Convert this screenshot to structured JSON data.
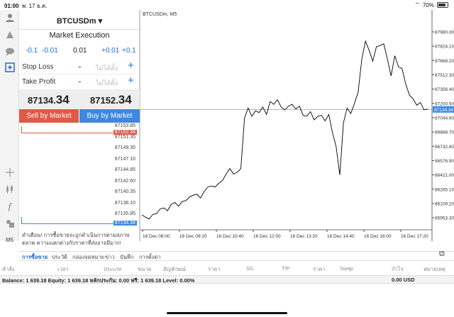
{
  "status": {
    "time": "01:00",
    "date": "พ. 17 ธ.ค.",
    "battery": "70%",
    "battery_level": 0.7
  },
  "order_panel": {
    "symbol": "BTCUSDm",
    "execution": "Market Execution",
    "adjust": [
      "-0.1",
      "-0.01",
      "0.01",
      "+0.01",
      "+0.1"
    ],
    "stop_loss": {
      "label": "Stop Loss",
      "placeholder": "ไม่ได้ตั้ง"
    },
    "take_profit": {
      "label": "Take Profit",
      "placeholder": "ไม่ได้ตั้ง"
    },
    "bid": {
      "main": "87134.",
      "big": "34"
    },
    "ask": {
      "main": "87152.",
      "big": "34"
    },
    "sell_label": "Sell by Market",
    "buy_label": "Buy by Market",
    "ladder": [
      "87153.85",
      "87151.35",
      "87149.35",
      "87147.10",
      "87144.85",
      "87142.60",
      "87140.35",
      "87138.10",
      "87135.85"
    ],
    "ask_tag": "87152.34",
    "bid_tag": "87134.34",
    "warning": "คำเตือน! การซื้อขายจะถูกดำเนินการตามสภาพตลาด ความแตกต่างกับราคาที่ส่งอาจมีมาก!"
  },
  "chart": {
    "title": "BTCUSDm, M5",
    "price_labels": [
      "87980.00",
      "87824.10",
      "87668.20",
      "87512.30",
      "87356.40",
      "87200.50",
      "87044.60",
      "86888.70",
      "86732.80",
      "86576.90",
      "86421.00",
      "86265.10",
      "86109.20",
      "85953.30"
    ],
    "bid_tag": "87134.34",
    "time_labels": [
      "16 Dec 08:00",
      "16 Dec 09:20",
      "16 Dec 10:40",
      "16 Dec 12:00",
      "16 Dec 13:20",
      "16 Dec 14:40",
      "16 Dec 16:00",
      "16 Dec 17:20"
    ],
    "colors": {
      "line": "#000000",
      "bid_line": "#9aa7b5",
      "bid_tag_bg": "#3d88e0"
    }
  },
  "chart_data": {
    "type": "line",
    "title": "BTCUSDm, M5",
    "ylim": [
      85900,
      88080
    ],
    "y": [
      85985,
      85960,
      85940,
      85990,
      86000,
      86050,
      86060,
      86030,
      86100,
      86120,
      86080,
      86130,
      86140,
      86180,
      86200,
      86210,
      86170,
      86240,
      86290,
      86300,
      86290,
      86330,
      86360,
      86430,
      86490,
      86430,
      86450,
      86490,
      87040,
      87150,
      87060,
      87120,
      87100,
      87160,
      87080,
      87220,
      87190,
      87240,
      87160,
      87130,
      87170,
      87190,
      87140,
      87170,
      87070,
      87060,
      87110,
      87020,
      87060,
      87070,
      87010,
      87080,
      86880,
      86730,
      86420,
      86990,
      87150,
      87090,
      87200,
      87320,
      87680,
      87880,
      87780,
      87660,
      87820,
      87830,
      87850,
      87680,
      87500,
      87720,
      87600,
      87580,
      87410,
      87290,
      87250,
      87180,
      87210,
      87130,
      87140
    ],
    "grid": false
  },
  "tabs": [
    "การซื้อขาย",
    "ประวัติ",
    "กล่องจดหมาย",
    "ข่าว",
    "บันทึก",
    "การตั้งค่า"
  ],
  "columns": [
    "คำสั่ง",
    "เวลา",
    "ประเภท",
    "ขนาด",
    "สัญลักษณ์",
    "ราคา",
    "S/L",
    "T/P",
    "ราคา",
    "Swap",
    "กำไร",
    "หมายเหตุ"
  ],
  "balance": {
    "text": "Balance: 1 639.18 Equity: 1 639.18 หลักประกัน: 0.00 ฟรี: 1 639.18 Level: 0.00%",
    "profit": "0.00 USD"
  }
}
